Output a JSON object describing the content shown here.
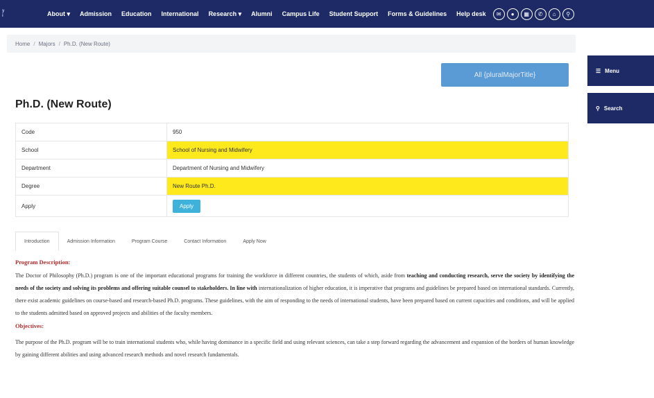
{
  "nav": {
    "logo_lines": [
      "y",
      "i"
    ],
    "items": [
      "About ▾",
      "Admission",
      "Education",
      "International",
      "Research ▾",
      "Alumni",
      "Campus Life",
      "Student Support",
      "Forms & Guidelines",
      "Help desk"
    ],
    "icons": [
      "envelope-icon",
      "user-icon",
      "calendar-icon",
      "phone-icon",
      "home-icon",
      "search-icon"
    ]
  },
  "breadcrumb": {
    "home": "Home",
    "majors": "Majors",
    "current": "Ph.D. (New Route)"
  },
  "side": {
    "menu": "Menu",
    "search": "Search"
  },
  "all_button": "All {pluralMajorTitle}",
  "title": "Ph.D. (New Route)",
  "details": {
    "code_label": "Code",
    "code_value": "950",
    "school_label": "School",
    "school_value": "School of Nursing and Midwifery",
    "department_label": "Department",
    "department_value": "Department of Nursing and Midwifery",
    "degree_label": "Degree",
    "degree_value": "New Route Ph.D.",
    "apply_label": "Apply",
    "apply_button": "Apply"
  },
  "tabs": [
    "Introduction",
    "Admission Information",
    "Program Course",
    "Contact Information",
    "Apply Now"
  ],
  "content": {
    "description_heading": "Program Description:",
    "description_line1": "The Doctor of Philosophy (Ph.D.) program is one of the important educational programs for training the workforce in different countries, the students of which, aside from",
    "description_bold": "teaching and conducting research, serve the society by identifying the needs of the society and solving its problems and offering suitable counsel to stakeholders. In line with",
    "description_rest": "internationalization of higher education, it is imperative that programs and guidelines be prepared based on international standards. Currently, there exist academic guidelines on course-based and research-based Ph.D. programs. These guidelines, with the aim of responding to the needs of international students, have been prepared based on current capacities and conditions, and will be applied to the students admitted based on approved projects and abilities of the faculty members.",
    "objectives_heading": "Objectives:",
    "objectives_text": "The purpose of the Ph.D. program will be to train international students who, while having dominance in a specific field and using relevant sciences, can take a step forward regarding the advancement and expansion of the borders of human knowledge by gaining different abilities and using advanced research methods and novel research fundamentals."
  }
}
